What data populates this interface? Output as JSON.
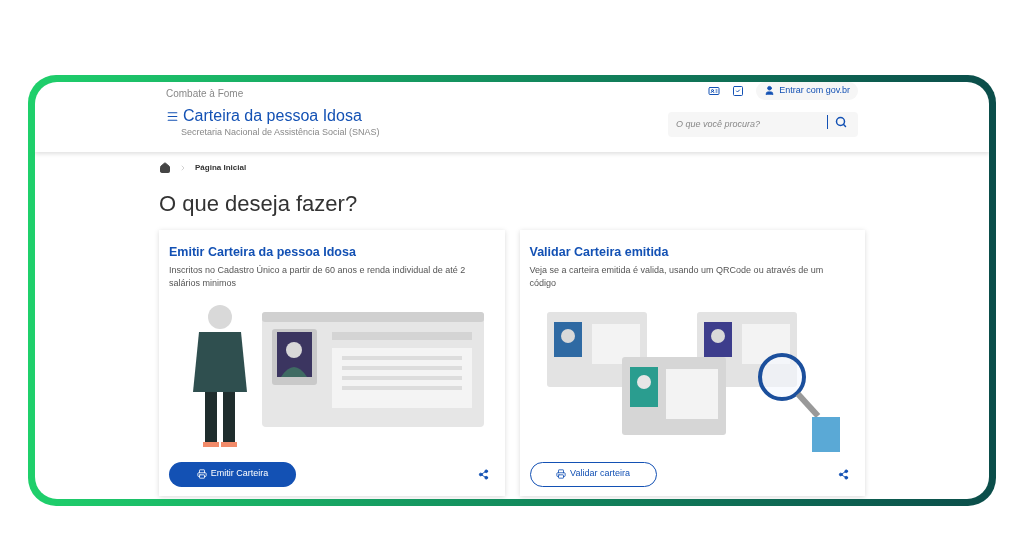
{
  "header": {
    "ministry": "Combate à Fome",
    "login": "Entrar com gov.br",
    "title": "Carteira da pessoa Idosa",
    "subtitle": "Secretaria Nacional de Assistência Social (SNAS)",
    "search": {
      "placeholder": "O que você procura?"
    }
  },
  "breadcrumb": [
    "Página Inicial"
  ],
  "heading": "O que deseja fazer?",
  "cards": [
    {
      "kind": "issue",
      "title": "Emitir Carteira da pessoa Idosa",
      "description": "Inscritos no Cadastro Único a partir de 60 anos e renda individual de até 2 salários minimos",
      "button": "Emitir Carteira",
      "primary": true
    },
    {
      "kind": "validate",
      "title": "Validar Carteira emitida",
      "description": "Veja se a carteira emitida é valida, usando um QRCode ou através de um código",
      "button": "Validar carteira",
      "primary": false
    }
  ]
}
